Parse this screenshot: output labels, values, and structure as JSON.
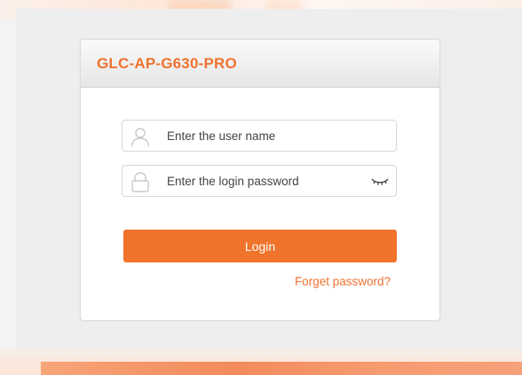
{
  "device": {
    "title": "GLC-AP-G630-PRO"
  },
  "login_form": {
    "username": {
      "placeholder": "Enter the user name",
      "value": "",
      "icon": "user-icon"
    },
    "password": {
      "placeholder": "Enter the login password",
      "value": "",
      "icon": "lock-icon",
      "toggle_icon": "eye-closed-icon"
    },
    "login_label": "Login",
    "forget_label": "Forget password?"
  },
  "colors": {
    "accent": "#f0732c",
    "title": "#ef7230",
    "card_background": "#ffffff",
    "page_background": "#efeeee"
  }
}
